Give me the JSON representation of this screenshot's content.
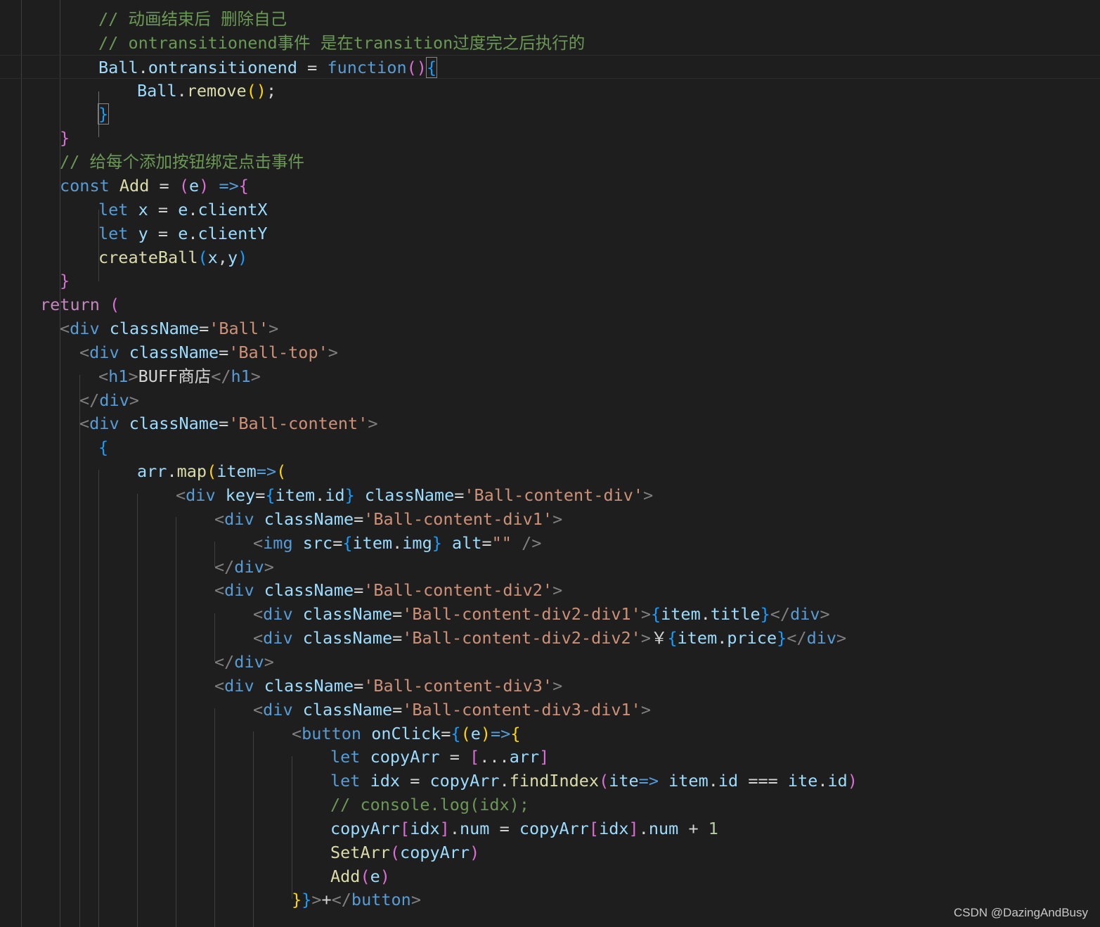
{
  "colors": {
    "background": "#1e1e1e",
    "comment": "#6a9955",
    "variable": "#9cdcfe",
    "function": "#dcdcaa",
    "keyword": "#569cd6",
    "control": "#c586c0",
    "string": "#ce9178",
    "number": "#b5cea8",
    "bracket_gold": "#ffd700",
    "bracket_orchid": "#da70d6",
    "bracket_blue": "#179fff"
  },
  "code_lines": [
    [
      [
        "c-comment",
        "// 动画结束后 删除自己"
      ]
    ],
    [
      [
        "c-comment",
        "// ontransitionend事件 是在transition过度完之后执行的"
      ]
    ],
    [
      [
        "c-var",
        "Ball"
      ],
      [
        "c-text",
        "."
      ],
      [
        "c-var",
        "ontransitionend"
      ],
      [
        "c-text",
        " = "
      ],
      [
        "c-kw",
        "function"
      ],
      [
        "c-b2",
        "("
      ],
      [
        "c-b2",
        ")"
      ],
      [
        "c-b3 c-match",
        "{"
      ]
    ],
    [
      [
        "c-var",
        "Ball"
      ],
      [
        "c-text",
        "."
      ],
      [
        "c-fn",
        "remove"
      ],
      [
        "c-b1",
        "("
      ],
      [
        "c-b1",
        ")"
      ],
      [
        "c-text",
        ";"
      ]
    ],
    [
      [
        "c-b3 c-match",
        "}"
      ]
    ],
    [
      [
        "c-b2",
        "}"
      ]
    ],
    [
      [
        "c-comment",
        "// 给每个添加按钮绑定点击事件"
      ]
    ],
    [
      [
        "c-kw",
        "const"
      ],
      [
        "c-text",
        " "
      ],
      [
        "c-fn",
        "Add"
      ],
      [
        "c-text",
        " = "
      ],
      [
        "c-b2",
        "("
      ],
      [
        "c-var",
        "e"
      ],
      [
        "c-b2",
        ")"
      ],
      [
        "c-text",
        " "
      ],
      [
        "c-kw",
        "=>"
      ],
      [
        "c-b2",
        "{"
      ]
    ],
    [
      [
        "c-kw",
        "let"
      ],
      [
        "c-text",
        " "
      ],
      [
        "c-var",
        "x"
      ],
      [
        "c-text",
        " = "
      ],
      [
        "c-var",
        "e"
      ],
      [
        "c-text",
        "."
      ],
      [
        "c-var",
        "clientX"
      ]
    ],
    [
      [
        "c-kw",
        "let"
      ],
      [
        "c-text",
        " "
      ],
      [
        "c-var",
        "y"
      ],
      [
        "c-text",
        " = "
      ],
      [
        "c-var",
        "e"
      ],
      [
        "c-text",
        "."
      ],
      [
        "c-var",
        "clientY"
      ]
    ],
    [
      [
        "c-fn",
        "createBall"
      ],
      [
        "c-b3",
        "("
      ],
      [
        "c-var",
        "x"
      ],
      [
        "c-text",
        ","
      ],
      [
        "c-var",
        "y"
      ],
      [
        "c-b3",
        ")"
      ]
    ],
    [
      [
        "c-b2",
        "}"
      ]
    ],
    [
      [
        "c-ctl",
        "return"
      ],
      [
        "c-text",
        " "
      ],
      [
        "c-b2",
        "("
      ]
    ],
    [
      [
        "c-ang",
        "<"
      ],
      [
        "c-tag",
        "div"
      ],
      [
        "c-text",
        " "
      ],
      [
        "c-attr",
        "className"
      ],
      [
        "c-text",
        "="
      ],
      [
        "c-str",
        "'Ball'"
      ],
      [
        "c-ang",
        ">"
      ]
    ],
    [
      [
        "c-ang",
        "<"
      ],
      [
        "c-tag",
        "div"
      ],
      [
        "c-text",
        " "
      ],
      [
        "c-attr",
        "className"
      ],
      [
        "c-text",
        "="
      ],
      [
        "c-str",
        "'Ball-top'"
      ],
      [
        "c-ang",
        ">"
      ]
    ],
    [
      [
        "c-ang",
        "<"
      ],
      [
        "c-tag",
        "h1"
      ],
      [
        "c-ang",
        ">"
      ],
      [
        "c-text",
        "BUFF商店"
      ],
      [
        "c-ang",
        "</"
      ],
      [
        "c-tag",
        "h1"
      ],
      [
        "c-ang",
        ">"
      ]
    ],
    [
      [
        "c-ang",
        "</"
      ],
      [
        "c-tag",
        "div"
      ],
      [
        "c-ang",
        ">"
      ]
    ],
    [
      [
        "c-ang",
        "<"
      ],
      [
        "c-tag",
        "div"
      ],
      [
        "c-text",
        " "
      ],
      [
        "c-attr",
        "className"
      ],
      [
        "c-text",
        "="
      ],
      [
        "c-str",
        "'Ball-content'"
      ],
      [
        "c-ang",
        ">"
      ]
    ],
    [
      [
        "c-b3",
        "{"
      ]
    ],
    [
      [
        "c-var",
        "arr"
      ],
      [
        "c-text",
        "."
      ],
      [
        "c-fn",
        "map"
      ],
      [
        "c-b1",
        "("
      ],
      [
        "c-var",
        "item"
      ],
      [
        "c-kw",
        "=>"
      ],
      [
        "c-b1",
        "("
      ]
    ],
    [
      [
        "c-ang",
        "<"
      ],
      [
        "c-tag",
        "div"
      ],
      [
        "c-text",
        " "
      ],
      [
        "c-attr",
        "key"
      ],
      [
        "c-text",
        "="
      ],
      [
        "c-b3",
        "{"
      ],
      [
        "c-var",
        "item"
      ],
      [
        "c-text",
        "."
      ],
      [
        "c-var",
        "id"
      ],
      [
        "c-b3",
        "}"
      ],
      [
        "c-text",
        " "
      ],
      [
        "c-attr",
        "className"
      ],
      [
        "c-text",
        "="
      ],
      [
        "c-str",
        "'Ball-content-div'"
      ],
      [
        "c-ang",
        ">"
      ]
    ],
    [
      [
        "c-ang",
        "<"
      ],
      [
        "c-tag",
        "div"
      ],
      [
        "c-text",
        " "
      ],
      [
        "c-attr",
        "className"
      ],
      [
        "c-text",
        "="
      ],
      [
        "c-str",
        "'Ball-content-div1'"
      ],
      [
        "c-ang",
        ">"
      ]
    ],
    [
      [
        "c-ang",
        "<"
      ],
      [
        "c-tag",
        "img"
      ],
      [
        "c-text",
        " "
      ],
      [
        "c-attr",
        "src"
      ],
      [
        "c-text",
        "="
      ],
      [
        "c-b3",
        "{"
      ],
      [
        "c-var",
        "item"
      ],
      [
        "c-text",
        "."
      ],
      [
        "c-var",
        "img"
      ],
      [
        "c-b3",
        "}"
      ],
      [
        "c-text",
        " "
      ],
      [
        "c-attr",
        "alt"
      ],
      [
        "c-text",
        "="
      ],
      [
        "c-str",
        "\"\""
      ],
      [
        "c-text",
        " "
      ],
      [
        "c-ang",
        "/>"
      ]
    ],
    [
      [
        "c-ang",
        "</"
      ],
      [
        "c-tag",
        "div"
      ],
      [
        "c-ang",
        ">"
      ]
    ],
    [
      [
        "c-ang",
        "<"
      ],
      [
        "c-tag",
        "div"
      ],
      [
        "c-text",
        " "
      ],
      [
        "c-attr",
        "className"
      ],
      [
        "c-text",
        "="
      ],
      [
        "c-str",
        "'Ball-content-div2'"
      ],
      [
        "c-ang",
        ">"
      ]
    ],
    [
      [
        "c-ang",
        "<"
      ],
      [
        "c-tag",
        "div"
      ],
      [
        "c-text",
        " "
      ],
      [
        "c-attr",
        "className"
      ],
      [
        "c-text",
        "="
      ],
      [
        "c-str",
        "'Ball-content-div2-div1'"
      ],
      [
        "c-ang",
        ">"
      ],
      [
        "c-b3",
        "{"
      ],
      [
        "c-var",
        "item"
      ],
      [
        "c-text",
        "."
      ],
      [
        "c-var",
        "title"
      ],
      [
        "c-b3",
        "}"
      ],
      [
        "c-ang",
        "</"
      ],
      [
        "c-tag",
        "div"
      ],
      [
        "c-ang",
        ">"
      ]
    ],
    [
      [
        "c-ang",
        "<"
      ],
      [
        "c-tag",
        "div"
      ],
      [
        "c-text",
        " "
      ],
      [
        "c-attr",
        "className"
      ],
      [
        "c-text",
        "="
      ],
      [
        "c-str",
        "'Ball-content-div2-div2'"
      ],
      [
        "c-ang",
        ">"
      ],
      [
        "c-text",
        "￥"
      ],
      [
        "c-b3",
        "{"
      ],
      [
        "c-var",
        "item"
      ],
      [
        "c-text",
        "."
      ],
      [
        "c-var",
        "price"
      ],
      [
        "c-b3",
        "}"
      ],
      [
        "c-ang",
        "</"
      ],
      [
        "c-tag",
        "div"
      ],
      [
        "c-ang",
        ">"
      ]
    ],
    [
      [
        "c-ang",
        "</"
      ],
      [
        "c-tag",
        "div"
      ],
      [
        "c-ang",
        ">"
      ]
    ],
    [
      [
        "c-ang",
        "<"
      ],
      [
        "c-tag",
        "div"
      ],
      [
        "c-text",
        " "
      ],
      [
        "c-attr",
        "className"
      ],
      [
        "c-text",
        "="
      ],
      [
        "c-str",
        "'Ball-content-div3'"
      ],
      [
        "c-ang",
        ">"
      ]
    ],
    [
      [
        "c-ang",
        "<"
      ],
      [
        "c-tag",
        "div"
      ],
      [
        "c-text",
        " "
      ],
      [
        "c-attr",
        "className"
      ],
      [
        "c-text",
        "="
      ],
      [
        "c-str",
        "'Ball-content-div3-div1'"
      ],
      [
        "c-ang",
        ">"
      ]
    ],
    [
      [
        "c-ang",
        "<"
      ],
      [
        "c-tag",
        "button"
      ],
      [
        "c-text",
        " "
      ],
      [
        "c-attr",
        "onClick"
      ],
      [
        "c-text",
        "="
      ],
      [
        "c-b3",
        "{"
      ],
      [
        "c-b1",
        "("
      ],
      [
        "c-var",
        "e"
      ],
      [
        "c-b1",
        ")"
      ],
      [
        "c-kw",
        "=>"
      ],
      [
        "c-b1",
        "{"
      ]
    ],
    [
      [
        "c-kw",
        "let"
      ],
      [
        "c-text",
        " "
      ],
      [
        "c-var",
        "copyArr"
      ],
      [
        "c-text",
        " = "
      ],
      [
        "c-b2",
        "["
      ],
      [
        "c-text",
        "..."
      ],
      [
        "c-var",
        "arr"
      ],
      [
        "c-b2",
        "]"
      ]
    ],
    [
      [
        "c-kw",
        "let"
      ],
      [
        "c-text",
        " "
      ],
      [
        "c-var",
        "idx"
      ],
      [
        "c-text",
        " = "
      ],
      [
        "c-var",
        "copyArr"
      ],
      [
        "c-text",
        "."
      ],
      [
        "c-fn",
        "findIndex"
      ],
      [
        "c-b2",
        "("
      ],
      [
        "c-var",
        "ite"
      ],
      [
        "c-kw",
        "=>"
      ],
      [
        "c-text",
        " "
      ],
      [
        "c-var",
        "item"
      ],
      [
        "c-text",
        "."
      ],
      [
        "c-var",
        "id"
      ],
      [
        "c-text",
        " === "
      ],
      [
        "c-var",
        "ite"
      ],
      [
        "c-text",
        "."
      ],
      [
        "c-var",
        "id"
      ],
      [
        "c-b2",
        ")"
      ]
    ],
    [
      [
        "c-comment",
        "// console.log(idx);"
      ]
    ],
    [
      [
        "c-var",
        "copyArr"
      ],
      [
        "c-b2",
        "["
      ],
      [
        "c-var",
        "idx"
      ],
      [
        "c-b2",
        "]"
      ],
      [
        "c-text",
        "."
      ],
      [
        "c-var",
        "num"
      ],
      [
        "c-text",
        " = "
      ],
      [
        "c-var",
        "copyArr"
      ],
      [
        "c-b2",
        "["
      ],
      [
        "c-var",
        "idx"
      ],
      [
        "c-b2",
        "]"
      ],
      [
        "c-text",
        "."
      ],
      [
        "c-var",
        "num"
      ],
      [
        "c-text",
        " + "
      ],
      [
        "c-num",
        "1"
      ]
    ],
    [
      [
        "c-fn",
        "SetArr"
      ],
      [
        "c-b2",
        "("
      ],
      [
        "c-var",
        "copyArr"
      ],
      [
        "c-b2",
        ")"
      ]
    ],
    [
      [
        "c-fn",
        "Add"
      ],
      [
        "c-b2",
        "("
      ],
      [
        "c-var",
        "e"
      ],
      [
        "c-b2",
        ")"
      ]
    ],
    [
      [
        "c-b1",
        "}"
      ],
      [
        "c-b3",
        "}"
      ],
      [
        "c-ang",
        ">"
      ],
      [
        "c-text",
        "+"
      ],
      [
        "c-ang",
        "</"
      ],
      [
        "c-tag",
        "button"
      ],
      [
        "c-ang",
        ">"
      ]
    ]
  ],
  "watermark": "CSDN @DazingAndBusy"
}
